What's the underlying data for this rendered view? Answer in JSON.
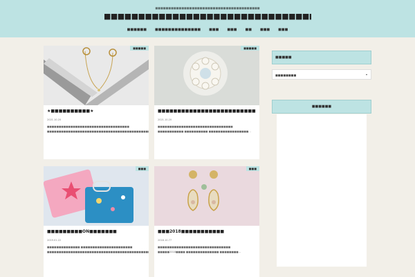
{
  "header": {
    "tagline": "■■■■■■■■■■■■■■■■■■■■■■■■■■■■■■■■■■■■■■■■",
    "title": "■■■■■■■■■■■■■■■■■■■■■■■■■■■■■■■■■■■■■■■■"
  },
  "nav": [
    "■■■■■■",
    "■■■■■■■■■■■■■■",
    "■■■",
    "■■■",
    "■■",
    "■■■",
    "■■■"
  ],
  "posts": [
    {
      "category": "■■■■■",
      "title": "★■■■■■■■■■■★",
      "date": "2021.10.20",
      "excerpt": "■■■■■■■■■■■■■■■■■■■■■■■■■■■■■■■■■■■ ■■■■■■■■■■■■■■■■■■■■■■■■■■■■■■■■■■■■■■■■■■■■■■■■■■■■■■■■■■■■■■■..."
    },
    {
      "category": "■■■■■",
      "title": "■■■■■■■■■■■■■■■■■■■■■■■■■■■■■",
      "date": "2021.10.20",
      "excerpt": "■■■■■■■■■■■■■■■■■■■■■■■■■■■■■■■■ ■■■■■■■■■■■ ■■■■■■■■■■ ■■■■■■■■■■■■■■■■■..."
    },
    {
      "category": "■■■",
      "title": "■■■■■■■■■ON■■■■■■■",
      "date": "2019.01.22",
      "excerpt": "■■■■■■■■■■■■■■ ■■■■■■■■■■■■■■■■■■■■■■ ■■■■■■■■■■■■■■■■■■■■■■■■■■■■■■■■■■■■■■■■■■■■■■■■..."
    },
    {
      "category": "■■■",
      "title": "■■■2018■■■■■■■■■■■",
      "date": "2018.10.77",
      "excerpt": "■■■■■■■■■■■■■■■■■■■■■■■■■■■■■■■ ■■■■■2018■■■■ ■■■■■■■■■■■■■■ ■■■■■■■■..."
    }
  ],
  "sidebar": {
    "archive_title": "■■■■■",
    "archive_select": "■■■■■■■■",
    "category_title": "■■■■■■"
  },
  "colors": {
    "accent": "#bde3e3",
    "background": "#f2efe8"
  }
}
